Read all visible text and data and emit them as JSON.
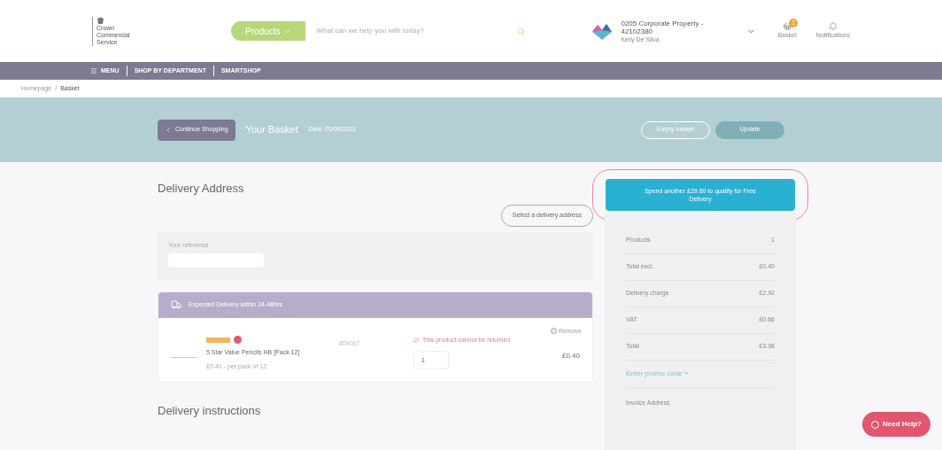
{
  "header": {
    "logo_lines": [
      "Crown",
      "Commercial",
      "Service"
    ],
    "products_button": "Products",
    "search": {
      "placeholder": "What can we help you with today?"
    },
    "account": {
      "name": "0205 Corporate Property - 42102380",
      "user": "Kelly De Silva"
    },
    "basket": {
      "label": "Basket",
      "count": "1"
    },
    "notifications": {
      "label": "Notifications"
    }
  },
  "nav": [
    {
      "label": "MENU",
      "kind": "menu"
    },
    {
      "label": "SHOP BY DEPARTMENT",
      "kind": "link"
    },
    {
      "label": "SMARTSHOP",
      "kind": "link"
    }
  ],
  "breadcrumb": {
    "items": [
      "Homepage",
      "Basket"
    ],
    "separator": "/"
  },
  "basket_bar": {
    "continue": "Continue Shopping",
    "title": "Your Basket",
    "date": "Date: 01/09/2021",
    "empty": "Empty basket",
    "update": "Update"
  },
  "delivery": {
    "title": "Delivery Address",
    "select_button": "Select a delivery address",
    "reference": {
      "label": "Your reference"
    },
    "group": {
      "title": "Expected Delivery within 24-48hrs",
      "remove": "Remove",
      "items": [
        {
          "name": "5 Star Value Pencils HB [Pack 12]",
          "code": "854067",
          "warning": "This product cannot be returned",
          "quantity": "1",
          "price": "£0.40",
          "unit_price": "£0.40 - per pack of 12"
        }
      ]
    }
  },
  "delivery_instructions": "Delivery instructions",
  "summary": {
    "free_delivery": "Spend another £29.60 to qualify for Free Delivery",
    "highlighted": true,
    "rows": [
      {
        "label": "Products",
        "value": "1"
      },
      {
        "label": "Total excl.",
        "value": "£0.40"
      },
      {
        "label": "Delivery charge",
        "value": "£2.92"
      },
      {
        "label": "VAT",
        "value": "£0.66"
      },
      {
        "label": "Total",
        "value": "£3.98"
      }
    ],
    "promo": "Enter promo code +",
    "invoice": "Invoice Address"
  },
  "help_button": "Need Help?"
}
